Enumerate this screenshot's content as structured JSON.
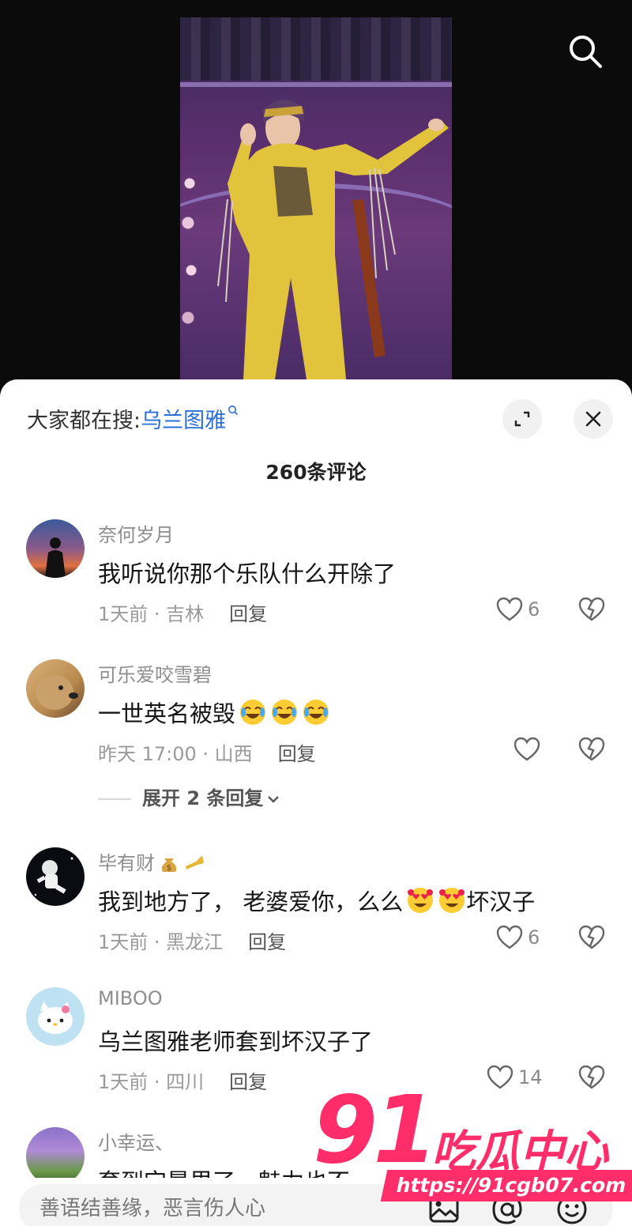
{
  "search_bar": {
    "label": "大家都在搜:",
    "keyword": "乌兰图雅"
  },
  "comment_count": "260条评论",
  "comments": [
    {
      "user": "奈何岁月",
      "text": "我听说你那个乐队什么开除了",
      "time_location": "1天前 · 吉林",
      "reply_label": "回复",
      "likes": "6"
    },
    {
      "user": "可乐爱咬雪碧",
      "text": "一世英名被毁",
      "emojis": [
        "crying-laughing",
        "crying-laughing",
        "crying-laughing"
      ],
      "time_location": "昨天 17:00 · 山西",
      "reply_label": "回复",
      "likes": "",
      "expand_replies": "展开 2 条回复"
    },
    {
      "user": "毕有财",
      "user_emojis": [
        "money-bag",
        "trumpet"
      ],
      "text_before": "我到地方了， 老婆爱你，么么",
      "emojis": [
        "heart-eyes",
        "heart-eyes"
      ],
      "text_after": "坏汉子",
      "time_location": "1天前 · 黑龙江",
      "reply_label": "回复",
      "likes": "6"
    },
    {
      "user": "MIBOO",
      "text": "乌兰图雅老师套到坏汉子了",
      "time_location": "1天前 · 四川",
      "reply_label": "回复",
      "likes": "14"
    },
    {
      "user": "小幸运、",
      "text": "套到宝暴里了，魅力也不"
    }
  ],
  "input": {
    "placeholder": "善语结善缘，恶言伤人心"
  },
  "watermark": {
    "number": "91",
    "name": "吃瓜中心",
    "url": "https://91cgb07.com"
  },
  "colors": {
    "accent": "#2a6fd8",
    "watermark": "#ff2d6a",
    "sheet": "#ffffff"
  }
}
